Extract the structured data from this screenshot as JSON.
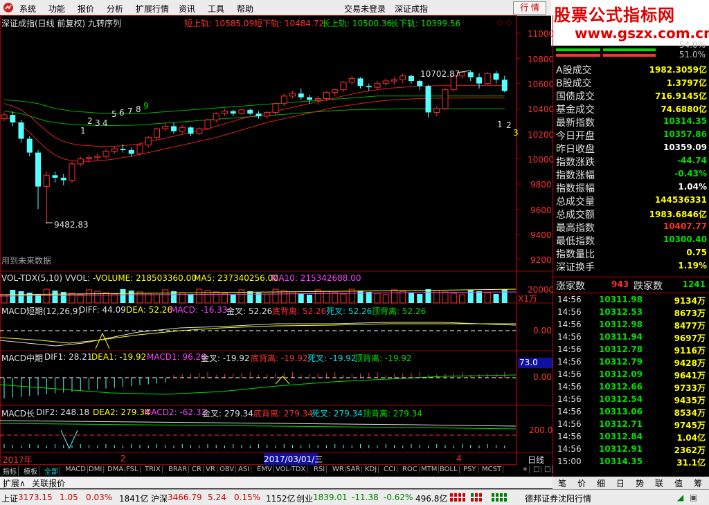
{
  "menu": {
    "items": [
      "系统",
      "功能",
      "报价",
      "分析",
      "扩展行情",
      "资讯",
      "工具",
      "帮助"
    ],
    "center_a": "交易未登录",
    "center_b": "深证成指",
    "quote_button": "行 情"
  },
  "brand": {
    "line1": "股票公式指标网",
    "line2": "www.gszx.com.cn"
  },
  "chart": {
    "title": "深证成指(日线 前复权) 九转序列",
    "legend": [
      {
        "label": "短上轨: 10585.09",
        "color": "#ff3030"
      },
      {
        "label": "短下轨: 10484.72",
        "color": "#ff3030"
      },
      {
        "label": "长上轨: 10500.36",
        "color": "#00e000"
      },
      {
        "label": "长下轨: 10399.56",
        "color": "#00e000"
      }
    ],
    "corner_marks": "◇ ◇",
    "high_label": "10702.87",
    "low_label": "9482.83",
    "future_note": "用到未来数据",
    "yticks": [
      "11000",
      "10800",
      "10600",
      "10400",
      "10200",
      "10000",
      "9800",
      "9600",
      "9400",
      "9200"
    ],
    "nine_seq_left": [
      "1",
      "2",
      "3",
      "4",
      "5",
      "6",
      "7",
      "8",
      "9"
    ],
    "nine_seq_right": [
      "1",
      "2",
      "3"
    ],
    "vol": {
      "label": "VOL-TDX(5,10) VVOL: -",
      "volume": "VOLUME: 218503360.00",
      "ma5": "MA5: 237340256.00",
      "ma10": "MA10: 215342688.00",
      "ytick": "20000",
      "unit": "X1万"
    },
    "macd1": {
      "name": "MACD短期(12,26,9)",
      "diff": "DIFF: 44.09",
      "dea": "DEA: 52.26",
      "macd": "MACD: -16.33",
      "gold": "金叉: 52.26",
      "bottom": "底背离: 52.26",
      "dead": "死叉: 52.26",
      "top": "顶背离: 52.26",
      "ytick": "0.00"
    },
    "macd2": {
      "name": "MACD中期",
      "dif": "DIF1: 28.21",
      "dea": "DEA1: -19.92",
      "macd": "MACD1: 96.26",
      "gold": "金叉: -19.92",
      "bottom": "底背离: -19.92",
      "dead": "死叉: -19.92",
      "top": "顶背离: -19.92",
      "ytick": "0.00",
      "badge": "73.0"
    },
    "macd3": {
      "name": "MACD长",
      "dif": "DIF2: 248.18",
      "dea": "DEA2: 279.34",
      "macd": "MACD2: -62.32",
      "gold": "金叉: 279.34",
      "bottom": "底背离: 279.34",
      "dead": "死叉: 279.34",
      "top": "顶背离: 279.34",
      "ytick": "200.0"
    },
    "timeline": {
      "year": "2017年",
      "m2": "2",
      "cursor": "2017/03/01/三",
      "m4": "4",
      "period": "日线"
    }
  },
  "indicator_tabs": [
    "指标",
    "模板",
    "全部",
    "MACD",
    "DMI",
    "DMA",
    "FSL",
    "TRIX",
    "BRAR",
    "CR",
    "VR",
    "OBV",
    "ASI",
    "EMV",
    "VOL-TDX",
    "RSI",
    "WR",
    "SAR",
    "KDJ",
    "CCI",
    "ROC",
    "MTM",
    "BOLL",
    "PSY",
    "MCST"
  ],
  "indicator_tab_extra": [
    "+",
    "□",
    "□"
  ],
  "ext_bar": [
    "扩展∧",
    "关联报价"
  ],
  "sidebar": {
    "top_pct_a": "54.0%",
    "top_pct_b": "51.0%",
    "rows": [
      {
        "k": "A股成交",
        "v": "1982.3059亿",
        "c": "#ffff00"
      },
      {
        "k": "B股成交",
        "v": "1.3797亿",
        "c": "#ffff00"
      },
      {
        "k": "国债成交",
        "v": "716.9145亿",
        "c": "#ffff00"
      },
      {
        "k": "基金成交",
        "v": "74.6880亿",
        "c": "#ffff00"
      },
      {
        "k": "最新指数",
        "v": "10314.35",
        "c": "#00e000"
      },
      {
        "k": "今日开盘",
        "v": "10357.86",
        "c": "#00e000"
      },
      {
        "k": "昨日收盘",
        "v": "10359.09",
        "c": "#ffffff"
      },
      {
        "k": "指数涨跌",
        "v": "-44.74",
        "c": "#00e000"
      },
      {
        "k": "指数涨幅",
        "v": "-0.43%",
        "c": "#00e000"
      },
      {
        "k": "指数振幅",
        "v": "1.04%",
        "c": "#ffffff"
      },
      {
        "k": "总成交量",
        "v": "144536331",
        "c": "#ffff00"
      },
      {
        "k": "总成交额",
        "v": "1983.6846亿",
        "c": "#ffff00"
      },
      {
        "k": "最高指数",
        "v": "10407.77",
        "c": "#ff3030"
      },
      {
        "k": "最低指数",
        "v": "10300.40",
        "c": "#00e000"
      },
      {
        "k": "指数量比",
        "v": "0.75",
        "c": "#ffff00"
      },
      {
        "k": "深证换手",
        "v": "1.19%",
        "c": "#ffff00"
      }
    ],
    "updown": {
      "up_label": "涨家数",
      "up": "943",
      "down_label": "跌家数",
      "down": "1241"
    },
    "ticks": [
      {
        "t": "14:56",
        "p": "10311.98",
        "q": "9134万"
      },
      {
        "t": "14:56",
        "p": "10312.53",
        "q": "8673万"
      },
      {
        "t": "14:56",
        "p": "10312.98",
        "q": "8477万"
      },
      {
        "t": "14:56",
        "p": "10311.94",
        "q": "9697万"
      },
      {
        "t": "14:56",
        "p": "10312.78",
        "q": "9116万"
      },
      {
        "t": "14:56",
        "p": "10312.79",
        "q": "9428万"
      },
      {
        "t": "14:56",
        "p": "10312.09",
        "q": "9641万"
      },
      {
        "t": "14:56",
        "p": "10312.66",
        "q": "9733万"
      },
      {
        "t": "14:56",
        "p": "10312.54",
        "q": "9435万"
      },
      {
        "t": "14:56",
        "p": "10313.06",
        "q": "8534万"
      },
      {
        "t": "14:56",
        "p": "10312.71",
        "q": "9745万"
      },
      {
        "t": "14:56",
        "p": "10312.84",
        "q": "1.04亿"
      },
      {
        "t": "14:56",
        "p": "10312.91",
        "q": "2362万"
      },
      {
        "t": "15:00",
        "p": "10314.35",
        "q": "31.1亿"
      }
    ],
    "tabs": [
      "笔",
      "价",
      "细",
      "日",
      "势",
      "联",
      "值",
      "筹"
    ]
  },
  "status": {
    "sh_label": "上证",
    "sh_val": "3173.15",
    "sh_chg": "1.05",
    "sh_pct": "0.03%",
    "sh_amt": "1841亿",
    "hs_label": "沪深",
    "hs_val": "3466.79",
    "hs_chg": "5.24",
    "hs_pct": "0.15%",
    "hs_amt": "1152亿",
    "cy_label": "创业",
    "cy_val": "1839.01",
    "cy_chg": "-11.38",
    "cy_pct": "-0.62%",
    "cy_amt": "496.8亿",
    "broker": "德邦证券沈阳行情"
  },
  "chart_data": {
    "type": "candlestick",
    "title": "深证成指(日线 前复权) 九转序列",
    "ylim": [
      9200,
      11000
    ],
    "high": 10702.87,
    "low": 9482.83,
    "candles": [
      [
        10320,
        10370,
        10300,
        10350
      ],
      [
        10350,
        10380,
        10260,
        10290
      ],
      [
        10290,
        10310,
        10130,
        10160
      ],
      [
        10160,
        10180,
        10020,
        10050
      ],
      [
        10050,
        10070,
        9600,
        9780
      ],
      [
        9780,
        9900,
        9482.83,
        9870
      ],
      [
        9870,
        9900,
        9810,
        9850
      ],
      [
        9850,
        9880,
        9790,
        9830
      ],
      [
        9830,
        9980,
        9810,
        9960
      ],
      [
        9960,
        10020,
        9940,
        10000
      ],
      [
        10000,
        10030,
        9970,
        10010
      ],
      [
        10010,
        10040,
        9990,
        10020
      ],
      [
        10020,
        10080,
        10000,
        10060
      ],
      [
        10060,
        10100,
        10040,
        10080
      ],
      [
        10080,
        10120,
        10050,
        10070
      ],
      [
        10070,
        10090,
        10020,
        10040
      ],
      [
        10040,
        10120,
        10030,
        10110
      ],
      [
        10110,
        10180,
        10090,
        10170
      ],
      [
        10170,
        10250,
        10150,
        10240
      ],
      [
        10240,
        10290,
        10220,
        10260
      ],
      [
        10260,
        10290,
        10200,
        10220
      ],
      [
        10220,
        10270,
        10200,
        10250
      ],
      [
        10250,
        10260,
        10180,
        10200
      ],
      [
        10200,
        10250,
        10190,
        10240
      ],
      [
        10240,
        10320,
        10230,
        10310
      ],
      [
        10310,
        10370,
        10290,
        10360
      ],
      [
        10360,
        10400,
        10340,
        10380
      ],
      [
        10380,
        10390,
        10340,
        10360
      ],
      [
        10360,
        10400,
        10350,
        10390
      ],
      [
        10390,
        10400,
        10350,
        10360
      ],
      [
        10360,
        10380,
        10320,
        10340
      ],
      [
        10340,
        10380,
        10320,
        10370
      ],
      [
        10370,
        10450,
        10350,
        10440
      ],
      [
        10440,
        10520,
        10420,
        10500
      ],
      [
        10500,
        10540,
        10480,
        10520
      ],
      [
        10520,
        10560,
        10470,
        10490
      ],
      [
        10490,
        10510,
        10440,
        10470
      ],
      [
        10470,
        10500,
        10430,
        10480
      ],
      [
        10480,
        10540,
        10460,
        10530
      ],
      [
        10530,
        10560,
        10500,
        10550
      ],
      [
        10550,
        10620,
        10530,
        10610
      ],
      [
        10610,
        10660,
        10590,
        10640
      ],
      [
        10640,
        10650,
        10560,
        10580
      ],
      [
        10580,
        10600,
        10540,
        10570
      ],
      [
        10570,
        10620,
        10550,
        10600
      ],
      [
        10600,
        10640,
        10580,
        10620
      ],
      [
        10620,
        10650,
        10590,
        10630
      ],
      [
        10630,
        10680,
        10600,
        10660
      ],
      [
        10660,
        10670,
        10600,
        10620
      ],
      [
        10620,
        10630,
        10550,
        10580
      ],
      [
        10580,
        10590,
        10330,
        10370
      ],
      [
        10370,
        10420,
        10340,
        10400
      ],
      [
        10400,
        10560,
        10390,
        10550
      ],
      [
        10550,
        10680,
        10540,
        10660
      ],
      [
        10660,
        10702.87,
        10640,
        10690
      ],
      [
        10690,
        10700,
        10620,
        10650
      ],
      [
        10650,
        10680,
        10560,
        10600
      ],
      [
        10600,
        10690,
        10590,
        10680
      ],
      [
        10680,
        10700,
        10600,
        10630
      ],
      [
        10630,
        10660,
        10530,
        10540
      ]
    ],
    "long_upper": [
      10470,
      10465,
      10460,
      10450,
      10440,
      10420,
      10400,
      10390,
      10380,
      10375,
      10370,
      10365,
      10362,
      10360,
      10360,
      10360,
      10362,
      10365,
      10370,
      10375,
      10380,
      10385,
      10390,
      10395,
      10400,
      10405,
      10410,
      10415,
      10420,
      10425,
      10430,
      10435,
      10440,
      10445,
      10450,
      10455,
      10460,
      10465,
      10470,
      10475,
      10480,
      10485,
      10490,
      10495,
      10500,
      10500,
      10500,
      10500,
      10500,
      10500,
      10500,
      10500,
      10500,
      10500,
      10500,
      10500,
      10500,
      10500,
      10500,
      10500
    ],
    "long_lower": [
      10380,
      10370,
      10360,
      10340,
      10320,
      10300,
      10290,
      10280,
      10275,
      10270,
      10268,
      10266,
      10265,
      10265,
      10266,
      10268,
      10270,
      10275,
      10280,
      10285,
      10290,
      10295,
      10300,
      10305,
      10310,
      10315,
      10320,
      10325,
      10330,
      10335,
      10340,
      10345,
      10350,
      10355,
      10360,
      10365,
      10370,
      10375,
      10380,
      10385,
      10388,
      10390,
      10392,
      10394,
      10395,
      10396,
      10397,
      10398,
      10399,
      10399,
      10399,
      10399,
      10399,
      10399,
      10399,
      10399,
      10399,
      10399,
      10399,
      10399
    ],
    "short_upper": [
      10440,
      10420,
      10390,
      10340,
      10280,
      10220,
      10170,
      10140,
      10120,
      10110,
      10105,
      10100,
      10098,
      10100,
      10105,
      10112,
      10120,
      10135,
      10150,
      10165,
      10180,
      10195,
      10210,
      10225,
      10240,
      10260,
      10280,
      10300,
      10320,
      10335,
      10350,
      10365,
      10380,
      10395,
      10410,
      10425,
      10440,
      10455,
      10470,
      10485,
      10500,
      10515,
      10530,
      10540,
      10550,
      10560,
      10565,
      10570,
      10575,
      10578,
      10580,
      10582,
      10583,
      10584,
      10585,
      10585,
      10585,
      10585,
      10585,
      10585
    ],
    "short_lower": [
      10340,
      10310,
      10270,
      10210,
      10140,
      10080,
      10030,
      10000,
      9985,
      9980,
      9980,
      9985,
      9990,
      10000,
      10010,
      10020,
      10035,
      10050,
      10065,
      10080,
      10095,
      10110,
      10125,
      10140,
      10155,
      10170,
      10190,
      10210,
      10230,
      10250,
      10270,
      10290,
      10305,
      10320,
      10335,
      10350,
      10365,
      10380,
      10395,
      10410,
      10420,
      10430,
      10440,
      10450,
      10458,
      10465,
      10470,
      10474,
      10477,
      10480,
      10482,
      10483,
      10484,
      10484,
      10485,
      10485,
      10485,
      10485,
      10485,
      10485
    ]
  }
}
